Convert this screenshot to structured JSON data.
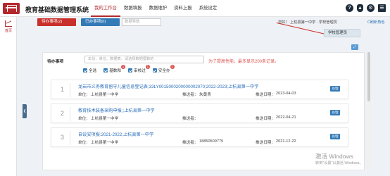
{
  "header": {
    "app_title": "教育基础数据管理系统",
    "nav": [
      "我的工作台",
      "数据填报",
      "数据维护",
      "资料上报",
      "系统设定"
    ],
    "active_nav": 0,
    "icons": [
      "help-icon",
      "bell-icon",
      "gear-icon",
      "menu-icon"
    ]
  },
  "sidebar": {
    "items": [
      {
        "label": "首页",
        "icon": "chart-icon"
      }
    ]
  },
  "toolbar": {
    "todo_label": "待办事项(2)",
    "done_label": "已办事项(0)",
    "search_placeholder": "数据导航",
    "user_info": "您好！ 上杭县第一中学 · 学校管理员",
    "refresh_label": "C刷新角色"
  },
  "dropdown": {
    "label": "学校管理员"
  },
  "panel": {
    "title": "待办事项",
    "search_placeholder": "年份、单位、数据表、请选择数据框数的",
    "notice": "为了提高性能，最多显示200条记录。",
    "filters": [
      {
        "label": "全选",
        "badge": ""
      },
      {
        "label": "基数和",
        "badge": "1"
      },
      {
        "label": "审核过",
        "badge": "1"
      },
      {
        "label": "安全办",
        "badge": "1"
      }
    ],
    "items": [
      {
        "num": "1",
        "title": "龙岩市义务教育留守儿童信息登记表;33LY0015000200000002070;2022-2023;上杭县第一中学",
        "unit_label": "单位：",
        "unit": "上杭县第一中学",
        "sender_label": "推送者：",
        "sender": "朱黄青",
        "date_label": "推送日期：",
        "date": "2023-04-03",
        "action": "处理"
      },
      {
        "num": "2",
        "title": "教育技术装备采购申报;;上杭县第一中学",
        "unit_label": "单位：",
        "unit": "上杭县第一中学",
        "sender_label": "推送者：",
        "sender": "",
        "date_label": "推送日期：",
        "date": "2022-04-21",
        "action": "处理"
      },
      {
        "num": "3",
        "title": "自设安项报:2021-2022;上杭县第一中学",
        "unit_label": "单位：",
        "unit": "上杭县第一中学",
        "sender_label": "推送者：",
        "sender": "18850509775",
        "date_label": "推送日期：",
        "date": "2021-12-22",
        "action": "处理"
      }
    ]
  },
  "watermark": {
    "line1": "激活 Windows",
    "line2": "转到\"设置\"以激活 Windows。"
  },
  "colors": {
    "brand": "#b4282d",
    "primary": "#337ab7",
    "danger": "#c9302c"
  }
}
